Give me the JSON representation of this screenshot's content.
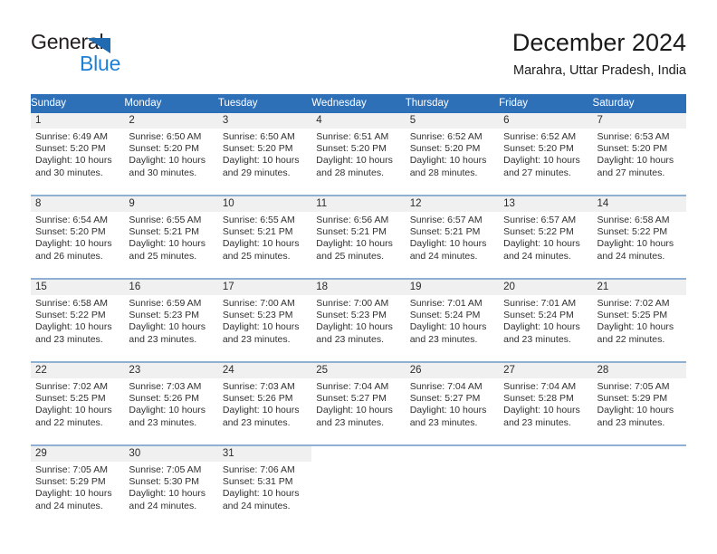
{
  "logo": {
    "word1": "General",
    "word2": "Blue",
    "triangle_color": "#1f6ab0",
    "blue_color": "#1f7fd4"
  },
  "header": {
    "title": "December 2024",
    "subtitle": "Marahra, Uttar Pradesh, India"
  },
  "theme": {
    "header_blue": "#2e70b8",
    "row_separator": "#8fb0d3",
    "daynum_band": "#f0f0f0"
  },
  "calendar": {
    "weekday_headers": [
      "Sunday",
      "Monday",
      "Tuesday",
      "Wednesday",
      "Thursday",
      "Friday",
      "Saturday"
    ],
    "weeks": [
      [
        {
          "day": "1",
          "sunrise": "Sunrise: 6:49 AM",
          "sunset": "Sunset: 5:20 PM",
          "daylight1": "Daylight: 10 hours",
          "daylight2": "and 30 minutes."
        },
        {
          "day": "2",
          "sunrise": "Sunrise: 6:50 AM",
          "sunset": "Sunset: 5:20 PM",
          "daylight1": "Daylight: 10 hours",
          "daylight2": "and 30 minutes."
        },
        {
          "day": "3",
          "sunrise": "Sunrise: 6:50 AM",
          "sunset": "Sunset: 5:20 PM",
          "daylight1": "Daylight: 10 hours",
          "daylight2": "and 29 minutes."
        },
        {
          "day": "4",
          "sunrise": "Sunrise: 6:51 AM",
          "sunset": "Sunset: 5:20 PM",
          "daylight1": "Daylight: 10 hours",
          "daylight2": "and 28 minutes."
        },
        {
          "day": "5",
          "sunrise": "Sunrise: 6:52 AM",
          "sunset": "Sunset: 5:20 PM",
          "daylight1": "Daylight: 10 hours",
          "daylight2": "and 28 minutes."
        },
        {
          "day": "6",
          "sunrise": "Sunrise: 6:52 AM",
          "sunset": "Sunset: 5:20 PM",
          "daylight1": "Daylight: 10 hours",
          "daylight2": "and 27 minutes."
        },
        {
          "day": "7",
          "sunrise": "Sunrise: 6:53 AM",
          "sunset": "Sunset: 5:20 PM",
          "daylight1": "Daylight: 10 hours",
          "daylight2": "and 27 minutes."
        }
      ],
      [
        {
          "day": "8",
          "sunrise": "Sunrise: 6:54 AM",
          "sunset": "Sunset: 5:20 PM",
          "daylight1": "Daylight: 10 hours",
          "daylight2": "and 26 minutes."
        },
        {
          "day": "9",
          "sunrise": "Sunrise: 6:55 AM",
          "sunset": "Sunset: 5:21 PM",
          "daylight1": "Daylight: 10 hours",
          "daylight2": "and 25 minutes."
        },
        {
          "day": "10",
          "sunrise": "Sunrise: 6:55 AM",
          "sunset": "Sunset: 5:21 PM",
          "daylight1": "Daylight: 10 hours",
          "daylight2": "and 25 minutes."
        },
        {
          "day": "11",
          "sunrise": "Sunrise: 6:56 AM",
          "sunset": "Sunset: 5:21 PM",
          "daylight1": "Daylight: 10 hours",
          "daylight2": "and 25 minutes."
        },
        {
          "day": "12",
          "sunrise": "Sunrise: 6:57 AM",
          "sunset": "Sunset: 5:21 PM",
          "daylight1": "Daylight: 10 hours",
          "daylight2": "and 24 minutes."
        },
        {
          "day": "13",
          "sunrise": "Sunrise: 6:57 AM",
          "sunset": "Sunset: 5:22 PM",
          "daylight1": "Daylight: 10 hours",
          "daylight2": "and 24 minutes."
        },
        {
          "day": "14",
          "sunrise": "Sunrise: 6:58 AM",
          "sunset": "Sunset: 5:22 PM",
          "daylight1": "Daylight: 10 hours",
          "daylight2": "and 24 minutes."
        }
      ],
      [
        {
          "day": "15",
          "sunrise": "Sunrise: 6:58 AM",
          "sunset": "Sunset: 5:22 PM",
          "daylight1": "Daylight: 10 hours",
          "daylight2": "and 23 minutes."
        },
        {
          "day": "16",
          "sunrise": "Sunrise: 6:59 AM",
          "sunset": "Sunset: 5:23 PM",
          "daylight1": "Daylight: 10 hours",
          "daylight2": "and 23 minutes."
        },
        {
          "day": "17",
          "sunrise": "Sunrise: 7:00 AM",
          "sunset": "Sunset: 5:23 PM",
          "daylight1": "Daylight: 10 hours",
          "daylight2": "and 23 minutes."
        },
        {
          "day": "18",
          "sunrise": "Sunrise: 7:00 AM",
          "sunset": "Sunset: 5:23 PM",
          "daylight1": "Daylight: 10 hours",
          "daylight2": "and 23 minutes."
        },
        {
          "day": "19",
          "sunrise": "Sunrise: 7:01 AM",
          "sunset": "Sunset: 5:24 PM",
          "daylight1": "Daylight: 10 hours",
          "daylight2": "and 23 minutes."
        },
        {
          "day": "20",
          "sunrise": "Sunrise: 7:01 AM",
          "sunset": "Sunset: 5:24 PM",
          "daylight1": "Daylight: 10 hours",
          "daylight2": "and 23 minutes."
        },
        {
          "day": "21",
          "sunrise": "Sunrise: 7:02 AM",
          "sunset": "Sunset: 5:25 PM",
          "daylight1": "Daylight: 10 hours",
          "daylight2": "and 22 minutes."
        }
      ],
      [
        {
          "day": "22",
          "sunrise": "Sunrise: 7:02 AM",
          "sunset": "Sunset: 5:25 PM",
          "daylight1": "Daylight: 10 hours",
          "daylight2": "and 22 minutes."
        },
        {
          "day": "23",
          "sunrise": "Sunrise: 7:03 AM",
          "sunset": "Sunset: 5:26 PM",
          "daylight1": "Daylight: 10 hours",
          "daylight2": "and 23 minutes."
        },
        {
          "day": "24",
          "sunrise": "Sunrise: 7:03 AM",
          "sunset": "Sunset: 5:26 PM",
          "daylight1": "Daylight: 10 hours",
          "daylight2": "and 23 minutes."
        },
        {
          "day": "25",
          "sunrise": "Sunrise: 7:04 AM",
          "sunset": "Sunset: 5:27 PM",
          "daylight1": "Daylight: 10 hours",
          "daylight2": "and 23 minutes."
        },
        {
          "day": "26",
          "sunrise": "Sunrise: 7:04 AM",
          "sunset": "Sunset: 5:27 PM",
          "daylight1": "Daylight: 10 hours",
          "daylight2": "and 23 minutes."
        },
        {
          "day": "27",
          "sunrise": "Sunrise: 7:04 AM",
          "sunset": "Sunset: 5:28 PM",
          "daylight1": "Daylight: 10 hours",
          "daylight2": "and 23 minutes."
        },
        {
          "day": "28",
          "sunrise": "Sunrise: 7:05 AM",
          "sunset": "Sunset: 5:29 PM",
          "daylight1": "Daylight: 10 hours",
          "daylight2": "and 23 minutes."
        }
      ],
      [
        {
          "day": "29",
          "sunrise": "Sunrise: 7:05 AM",
          "sunset": "Sunset: 5:29 PM",
          "daylight1": "Daylight: 10 hours",
          "daylight2": "and 24 minutes."
        },
        {
          "day": "30",
          "sunrise": "Sunrise: 7:05 AM",
          "sunset": "Sunset: 5:30 PM",
          "daylight1": "Daylight: 10 hours",
          "daylight2": "and 24 minutes."
        },
        {
          "day": "31",
          "sunrise": "Sunrise: 7:06 AM",
          "sunset": "Sunset: 5:31 PM",
          "daylight1": "Daylight: 10 hours",
          "daylight2": "and 24 minutes."
        },
        {
          "day": "",
          "sunrise": "",
          "sunset": "",
          "daylight1": "",
          "daylight2": ""
        },
        {
          "day": "",
          "sunrise": "",
          "sunset": "",
          "daylight1": "",
          "daylight2": ""
        },
        {
          "day": "",
          "sunrise": "",
          "sunset": "",
          "daylight1": "",
          "daylight2": ""
        },
        {
          "day": "",
          "sunrise": "",
          "sunset": "",
          "daylight1": "",
          "daylight2": ""
        }
      ]
    ]
  }
}
